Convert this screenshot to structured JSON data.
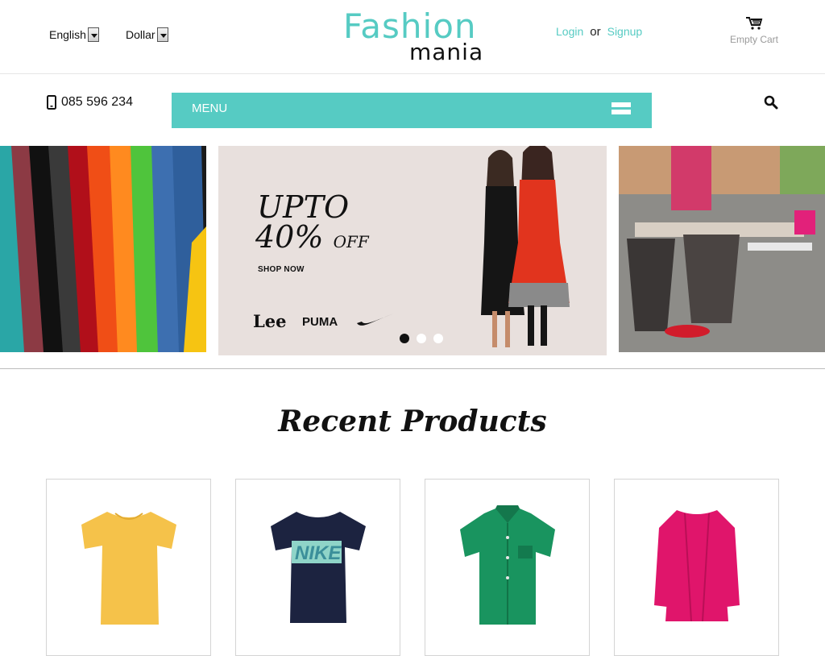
{
  "header": {
    "language": "English",
    "currency": "Dollar",
    "logo_top": "Fashion",
    "logo_bottom": "mania",
    "login": "Login",
    "or": "or",
    "signup": "Signup",
    "cart": "Empty Cart"
  },
  "nav": {
    "phone": "085 596 234",
    "menu": "MENU"
  },
  "hero": {
    "line1": "UPTO",
    "line2": "40%",
    "line2_suffix": "OFF",
    "cta": "SHOP NOW",
    "brands": [
      "Lee",
      "PUMA"
    ],
    "active_slide": 1,
    "slide_count": 3
  },
  "section": {
    "title": "Recent Products"
  },
  "products": [
    {
      "name": "yellow-tshirt",
      "color": "#f5c24a"
    },
    {
      "name": "navy-nike-tshirt",
      "color": "#1c2340"
    },
    {
      "name": "green-shirt",
      "color": "#19945f"
    },
    {
      "name": "pink-cardigan",
      "color": "#e0156b"
    }
  ],
  "colors": {
    "accent": "#56cbc3"
  }
}
